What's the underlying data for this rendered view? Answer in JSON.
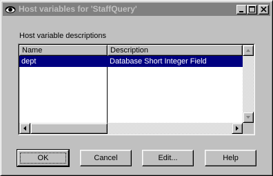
{
  "window": {
    "title": "Host variables for 'StaffQuery'",
    "icon": "eye-icon",
    "title_bar_color": "#808080",
    "title_text_color": "#c0c0c0",
    "controls": [
      "minimize-icon",
      "maximize-icon",
      "close-icon"
    ]
  },
  "group": {
    "label": "Host variable descriptions"
  },
  "list": {
    "columns": [
      "Name",
      "Description"
    ],
    "rows": [
      {
        "name": "dept",
        "description": "Database Short Integer Field",
        "selected": true
      }
    ],
    "selection_color": "#000080"
  },
  "buttons": {
    "ok": "OK",
    "cancel": "Cancel",
    "edit": "Edit...",
    "help": "Help"
  }
}
